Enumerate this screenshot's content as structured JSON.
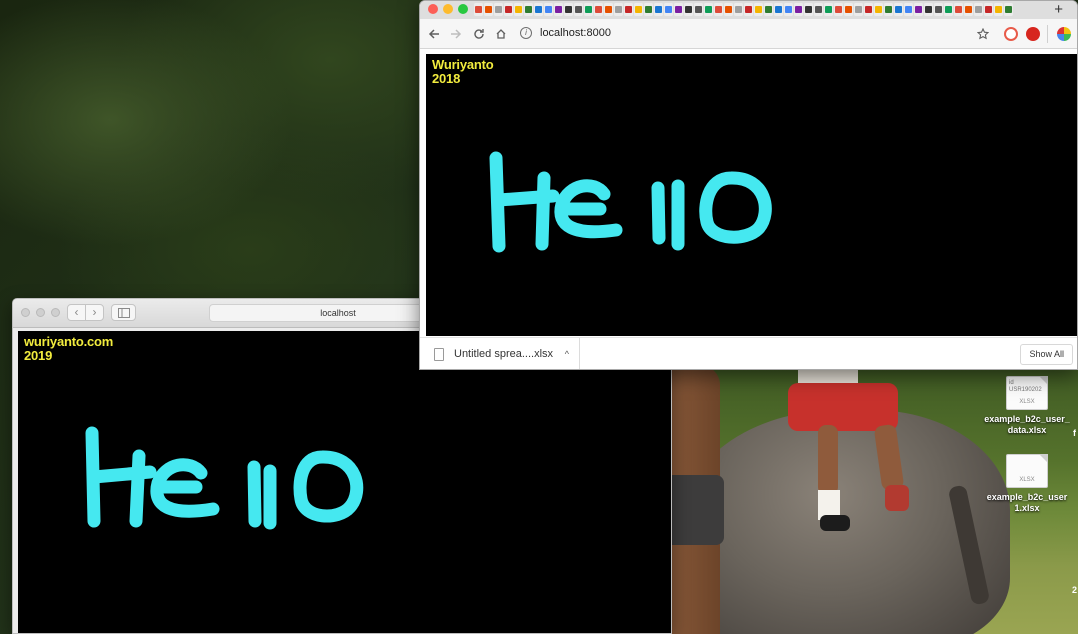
{
  "desktop": {
    "icons": [
      {
        "name": "example_b2c_user_data.xlsx",
        "line1": "example_b2c_user_",
        "line2": "data.xlsx",
        "glyph_text": "id\nUSR190202",
        "glyph_tag": "XLSX"
      },
      {
        "name": "example_b2c_user1.xlsx",
        "line1": "example_b2c_user",
        "line2": "1.xlsx",
        "glyph_text": "",
        "glyph_tag": "XLSX"
      }
    ],
    "edge_fragments": [
      "f",
      "2"
    ]
  },
  "safari": {
    "url": "localhost",
    "back_icon": "‹",
    "forward_icon": "›",
    "sidebar_icon": "sidebar-icon",
    "canvas": {
      "credit_line1": "wuriyanto.com",
      "credit_line2": "2019",
      "stroke_color": "#45e8f0",
      "credit_color": "#f2ec3e"
    }
  },
  "chrome": {
    "url": "localhost:8000",
    "new_tab": "+",
    "canvas": {
      "credit_line1": "Wuriyanto",
      "credit_line2": "2018",
      "stroke_color": "#45e8f0",
      "credit_color": "#f2ec3e"
    },
    "download": {
      "filename": "Untitled sprea....xlsx",
      "chevron": "^",
      "show_all": "Show All"
    }
  }
}
